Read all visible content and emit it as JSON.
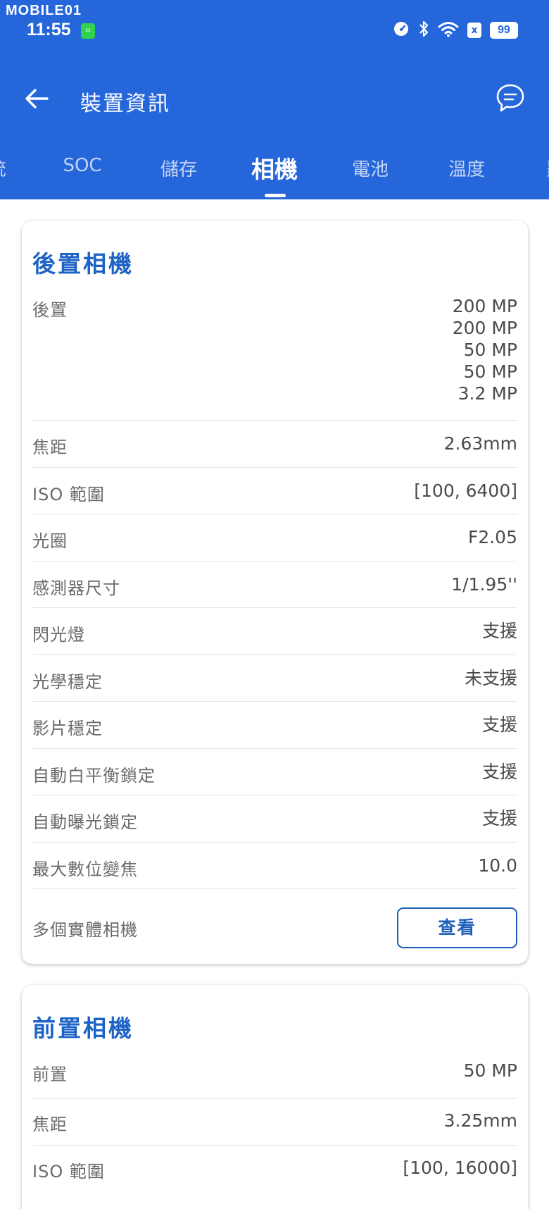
{
  "status_bar": {
    "watermark": "MOBILE01",
    "time": "11:55",
    "app_badge": "⌗",
    "x_badge": "x",
    "battery": "99"
  },
  "header": {
    "title": "裝置資訊"
  },
  "tabs": [
    {
      "label": "統"
    },
    {
      "label": "SOC"
    },
    {
      "label": "儲存"
    },
    {
      "label": "相機"
    },
    {
      "label": "電池"
    },
    {
      "label": "溫度"
    },
    {
      "label": "顯"
    }
  ],
  "active_tab": "相機",
  "rear_camera": {
    "title": "後置相機",
    "rows": [
      {
        "label": "後置",
        "values": [
          "200 MP",
          "200 MP",
          "50 MP",
          "50 MP",
          "3.2 MP"
        ]
      },
      {
        "label": "焦距",
        "value": "2.63mm"
      },
      {
        "label": "ISO 範圍",
        "value": "[100, 6400]"
      },
      {
        "label": "光圈",
        "value": "F2.05"
      },
      {
        "label": "感測器尺寸",
        "value": "1/1.95''"
      },
      {
        "label": "閃光燈",
        "value": "支援"
      },
      {
        "label": "光學穩定",
        "value": "未支援"
      },
      {
        "label": "影片穩定",
        "value": "支援"
      },
      {
        "label": "自動白平衡鎖定",
        "value": "支援"
      },
      {
        "label": "自動曝光鎖定",
        "value": "支援"
      },
      {
        "label": "最大數位變焦",
        "value": "10.0"
      },
      {
        "label": "多個實體相機",
        "button": "查看"
      }
    ]
  },
  "front_camera": {
    "title": "前置相機",
    "rows": [
      {
        "label": "前置",
        "value": "50 MP"
      },
      {
        "label": "焦距",
        "value": "3.25mm"
      },
      {
        "label": "ISO 範圍",
        "value": "[100, 16000]"
      }
    ]
  },
  "colors": {
    "app_bar": "#2566db",
    "accent": "#1d63c7",
    "button_border": "#1d5eb8"
  }
}
